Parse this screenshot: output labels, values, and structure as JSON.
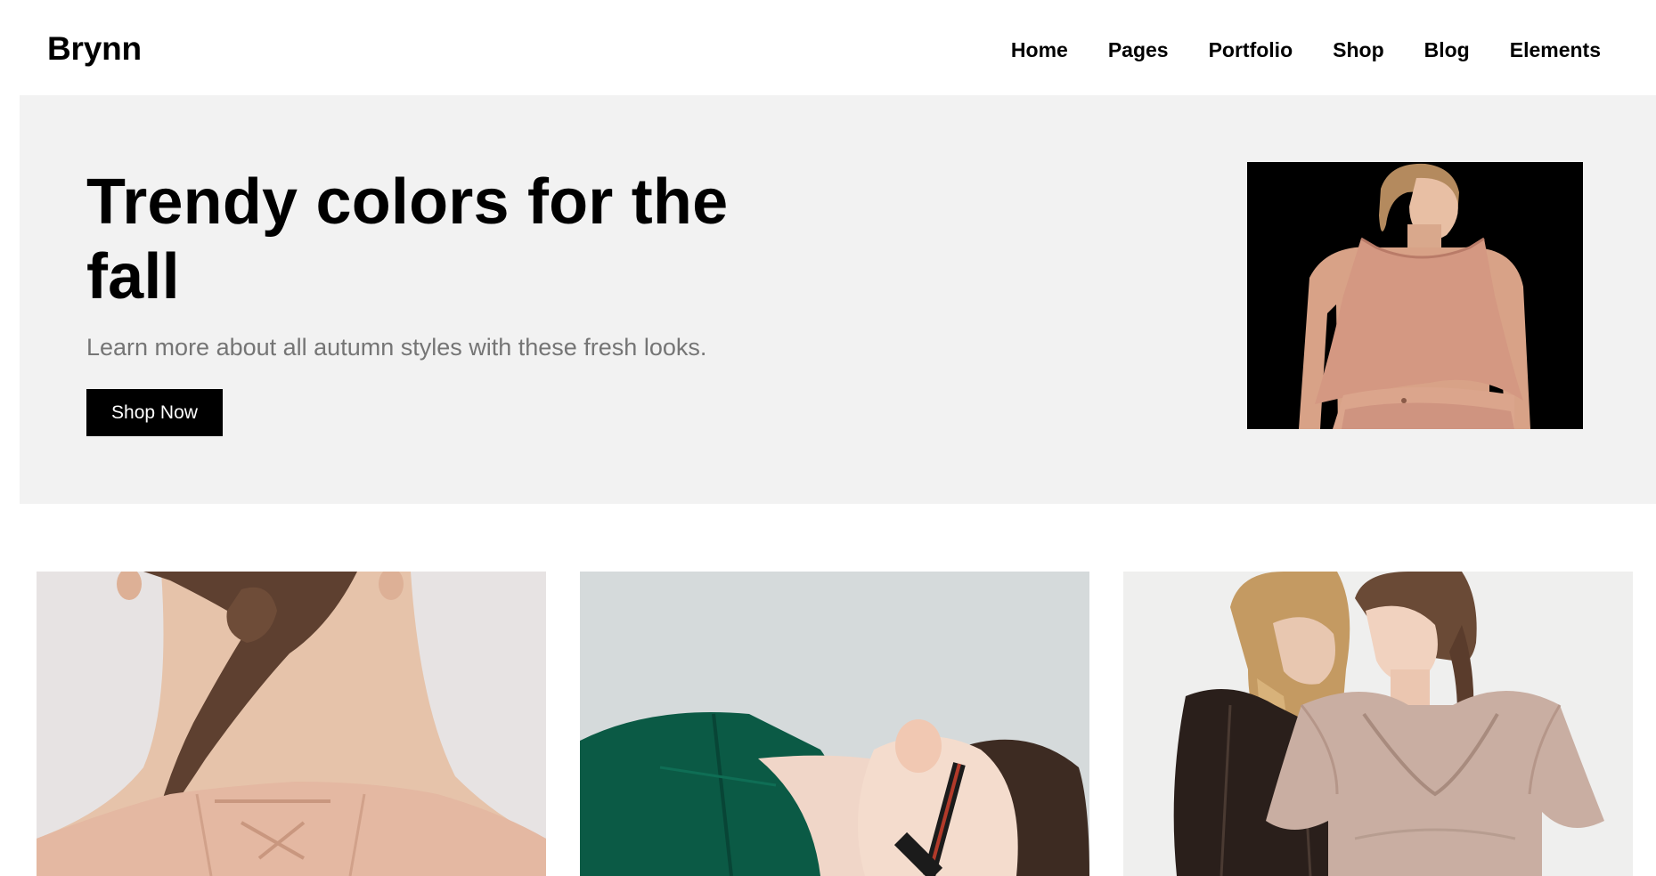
{
  "site": {
    "logo": "Brynn"
  },
  "nav": {
    "items": [
      "Home",
      "Pages",
      "Portfolio",
      "Shop",
      "Blog",
      "Elements"
    ]
  },
  "hero": {
    "title": "Trendy colors for the fall",
    "subtitle": "Learn more about all autumn styles with these fresh looks.",
    "button_label": "Shop Now"
  },
  "colors": {
    "hero_bg": "#f2f2f2",
    "button_bg": "#000000",
    "subtitle": "#757575"
  }
}
